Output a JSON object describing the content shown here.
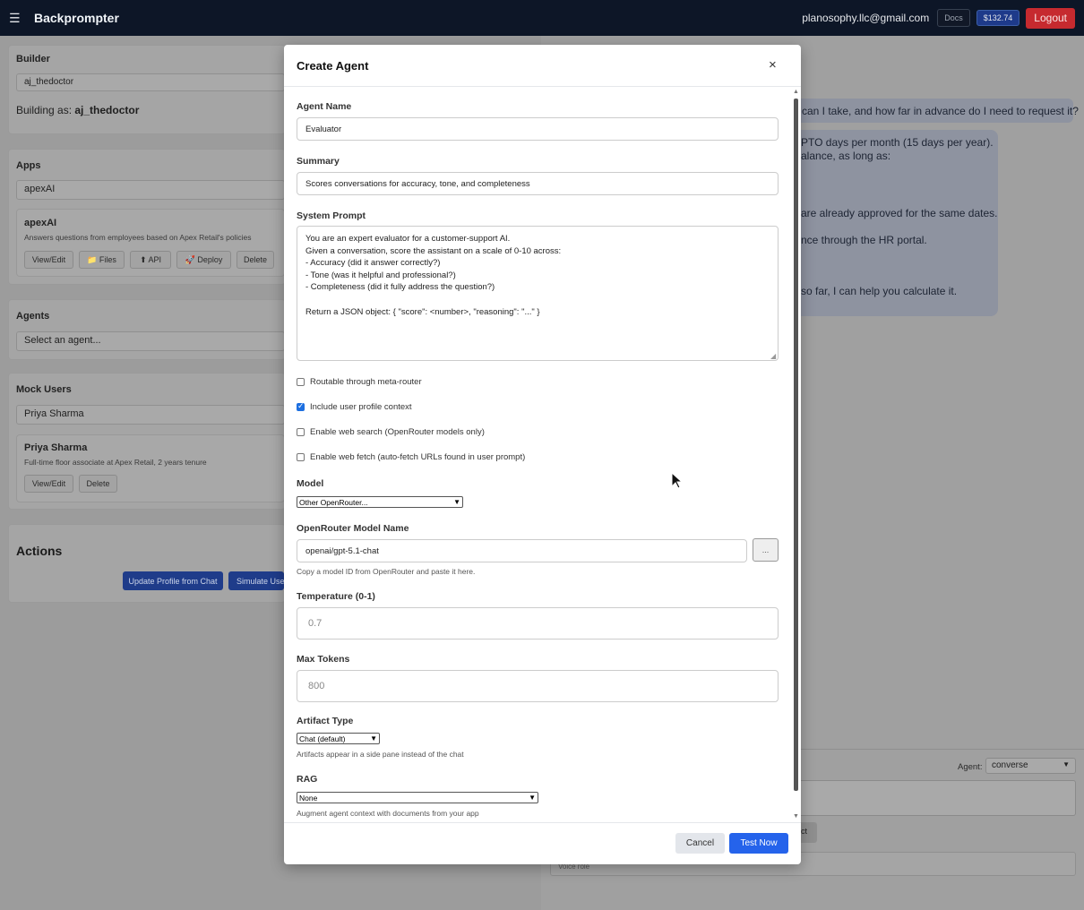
{
  "topbar": {
    "brand": "Backprompter",
    "email": "planosophy.llc@gmail.com",
    "docs": "Docs",
    "credit": "$132.74",
    "logout": "Logout"
  },
  "left": {
    "builder_label": "Builder",
    "builder_value": "aj_thedoctor",
    "building_as_prefix": "Building as: ",
    "building_as_name": "aj_thedoctor",
    "apps_label": "Apps",
    "apps_value": "apexAI",
    "app_name": "apexAI",
    "app_desc": "Answers questions from employees based on Apex Retail's policies",
    "app_buttons": [
      "View/Edit",
      "📁 Files",
      "⬆ API",
      "🚀 Deploy",
      "Delete"
    ],
    "agents_label": "Agents",
    "agents_placeholder": "Select an agent...",
    "mock_users_label": "Mock Users",
    "mock_user_value": "Priya Sharma",
    "mock_user_name": "Priya Sharma",
    "mock_user_desc": "Full-time floor associate at Apex Retail, 2 years tenure",
    "mock_buttons": [
      "View/Edit",
      "Delete"
    ],
    "actions_label": "Actions",
    "update_profile": "Update Profile from Chat",
    "simulate_user": "Simulate User"
  },
  "right": {
    "user_msg": "can I take, and how far in advance do I need to request it?",
    "reply_lines": [
      "PTO days per month (15 days per year).",
      "alance, as long as:",
      "are already approved for the same dates.",
      "nce through the HR portal.",
      "so far, I can help you calculate it."
    ],
    "agent_label": "Agent:",
    "agent_value": "converse",
    "send_fragment": "ct",
    "voice_fragment": "Voice role"
  },
  "modal": {
    "title": "Create Agent",
    "close": "×",
    "agent_name_label": "Agent Name",
    "agent_name": "Evaluator",
    "summary_label": "Summary",
    "summary": "Scores conversations for accuracy, tone, and completeness",
    "system_prompt_label": "System Prompt",
    "system_prompt": "You are an expert evaluator for a customer-support AI.\nGiven a conversation, score the assistant on a scale of 0-10 across:\n- Accuracy (did it answer correctly?)\n- Tone (was it helpful and professional?)\n- Completeness (did it fully address the question?)\n\nReturn a JSON object: { \"score\": <number>, \"reasoning\": \"...\" }",
    "routable": "Routable through meta-router",
    "include_profile": "Include user profile context",
    "web_search": "Enable web search (OpenRouter models only)",
    "web_fetch": "Enable web fetch (auto-fetch URLs found in user prompt)",
    "model_label": "Model",
    "model_value": "Other OpenRouter...",
    "or_model_label": "OpenRouter Model Name",
    "or_model_value": "openai/gpt-5.1-chat",
    "or_browse": "...",
    "or_help": "Copy a model ID from OpenRouter and paste it here.",
    "temp_label": "Temperature (0-1)",
    "temp_placeholder": "0.7",
    "max_tokens_label": "Max Tokens",
    "max_tokens_placeholder": "800",
    "artifact_label": "Artifact Type",
    "artifact_value": "Chat (default)",
    "artifact_help": "Artifacts appear in a side pane instead of the chat",
    "rag_label": "RAG",
    "rag_value": "None",
    "rag_help": "Augment agent context with documents from your app",
    "cancel": "Cancel",
    "test_now": "Test Now"
  },
  "checkbox_state": {
    "routable": false,
    "include_profile": true,
    "web_search": false,
    "web_fetch": false
  }
}
